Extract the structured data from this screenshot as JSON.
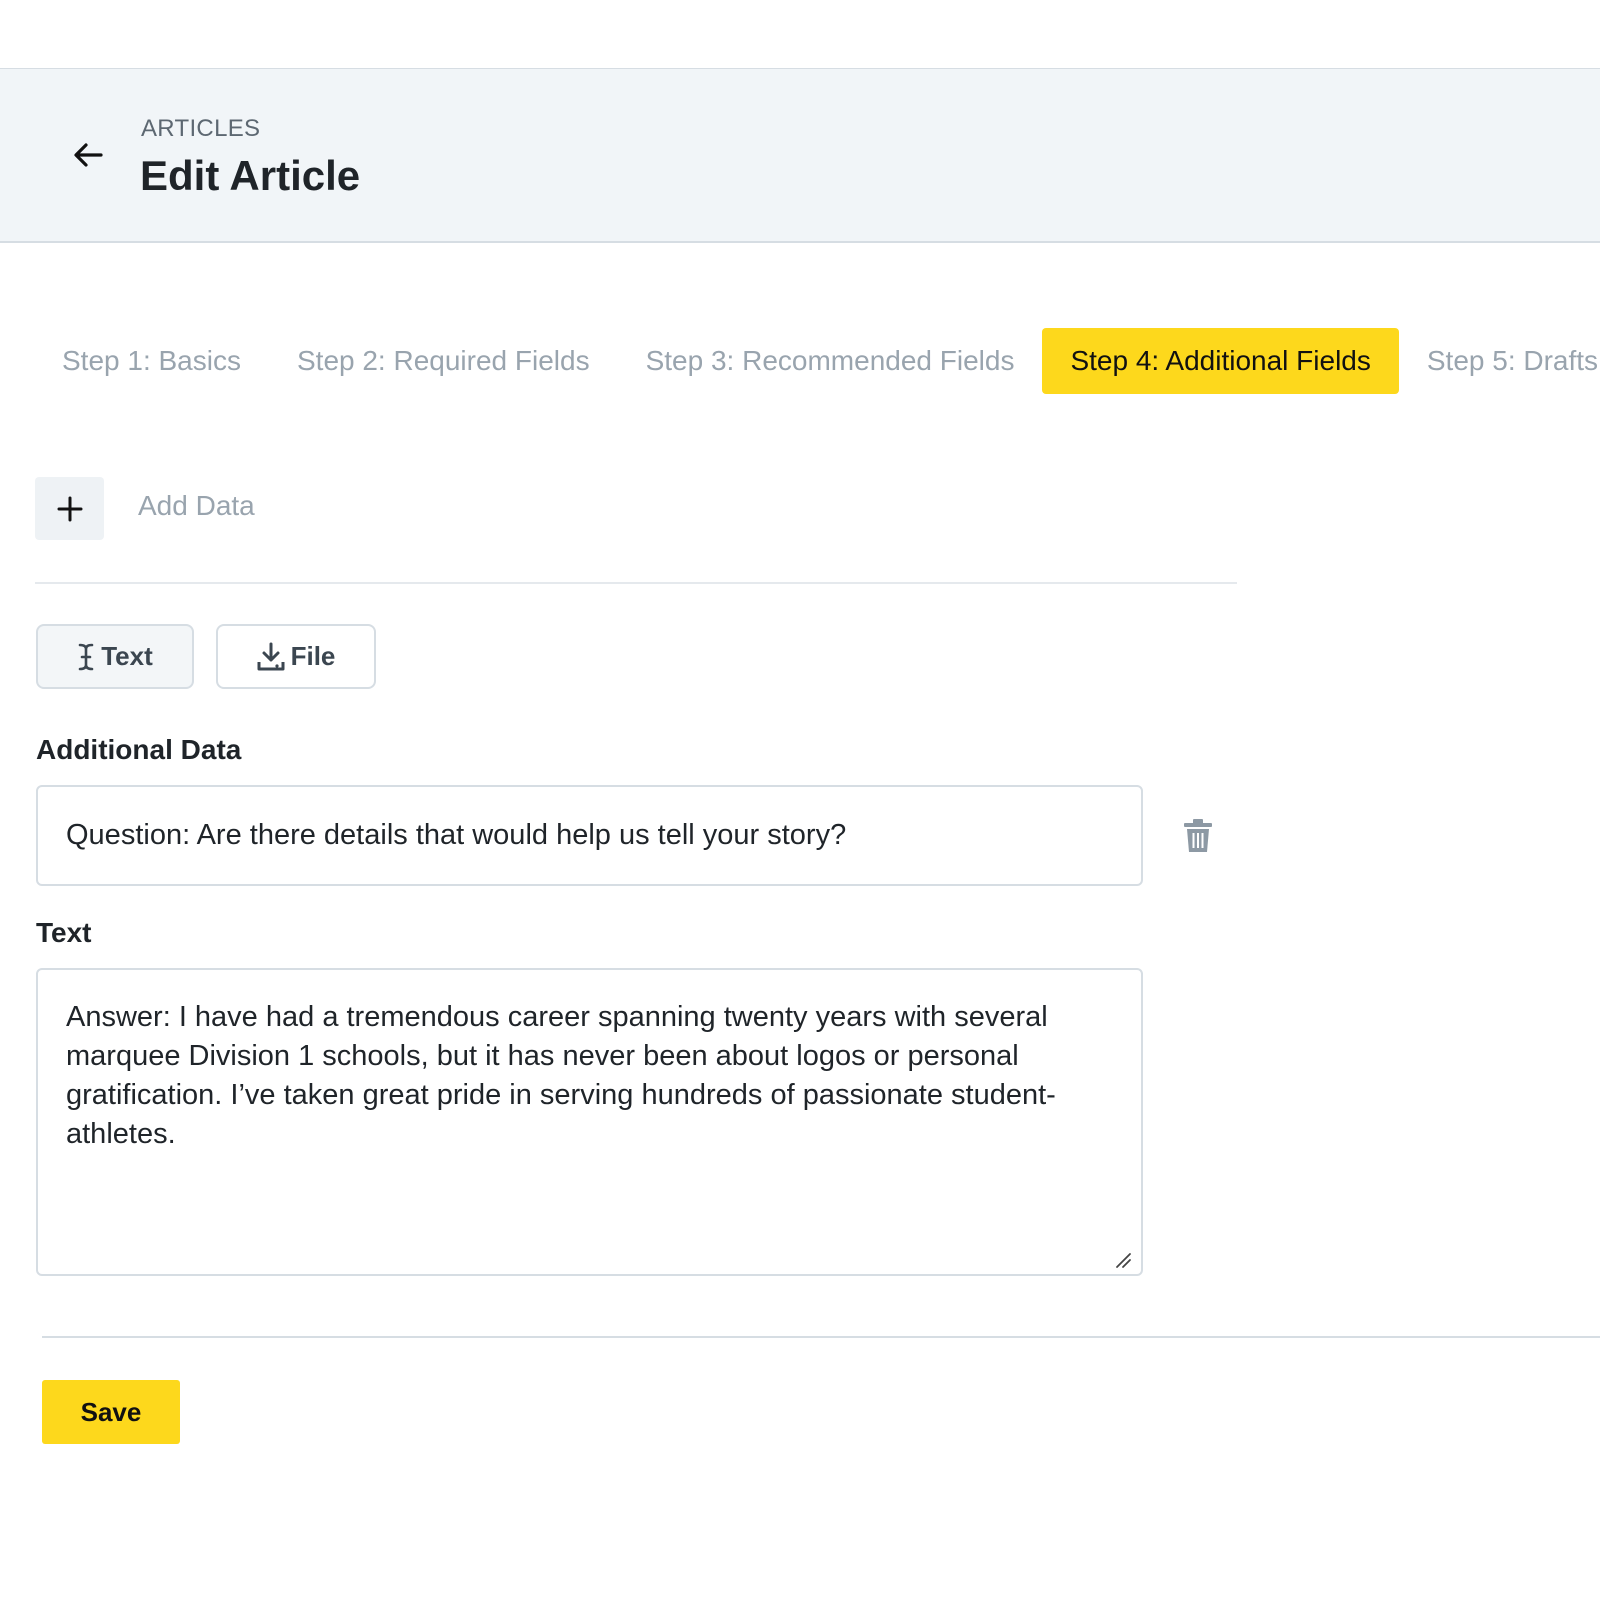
{
  "header": {
    "breadcrumb": "ARTICLES",
    "title": "Edit Article"
  },
  "tabs": [
    {
      "label": "Step 1: Basics",
      "active": false
    },
    {
      "label": "Step 2: Required Fields",
      "active": false
    },
    {
      "label": "Step 3: Recommended Fields",
      "active": false
    },
    {
      "label": "Step 4: Additional Fields",
      "active": true
    },
    {
      "label": "Step 5: Drafts",
      "active": false
    }
  ],
  "add_data": {
    "label": "Add Data",
    "icon": "plus-icon"
  },
  "type_buttons": {
    "text_label": "Text",
    "text_icon": "text-cursor-icon",
    "file_label": "File",
    "file_icon": "download-icon"
  },
  "fields": {
    "additional_label": "Additional Data",
    "additional_value": "Question: Are there details that would help us tell your story?",
    "text_label": "Text",
    "text_value": "Answer: I have had a tremendous career spanning twenty years with several marquee Division 1 schools, but it has never been about logos or personal gratification. I’ve taken great pride in serving hundreds of passionate student-athletes."
  },
  "actions": {
    "save_label": "Save"
  },
  "colors": {
    "accent": "#fdd81c",
    "header_bg": "#f1f5f8",
    "muted_text": "#99a4ae"
  }
}
